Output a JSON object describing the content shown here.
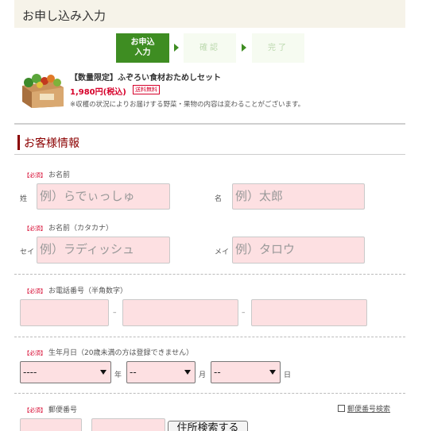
{
  "header": {
    "title": "お申し込み入力"
  },
  "steps": [
    {
      "label_line1": "お申込",
      "label_line2": "入力"
    },
    {
      "label": "確認"
    },
    {
      "label": "完了"
    }
  ],
  "product": {
    "name": "【数量限定】ふぞろい食材おためしセット",
    "price": "1,980円(税込)",
    "shipping_badge": "送料無料",
    "note": "※収穫の状況によりお届けする野菜・果物の内容は変わることがございます。"
  },
  "section": {
    "title": "お客様情報"
  },
  "form": {
    "required_tag": "【必須】",
    "name_label": "お名前",
    "last_name_prefix": "姓",
    "first_name_prefix": "名",
    "last_name_placeholder": "例）らでぃっしゅ",
    "first_name_placeholder": "例）太郎",
    "kana_label": "お名前（カタカナ）",
    "last_kana_prefix": "セイ",
    "first_kana_prefix": "メイ",
    "last_kana_placeholder": "例）ラディッシュ",
    "first_kana_placeholder": "例）タロウ",
    "phone_label": "お電話番号（半角数字）",
    "phone_separator": "–",
    "birth_label": "生年月日（20歳未満の方は登録できません）",
    "year_value": "----",
    "month_value": "--",
    "day_value": "--",
    "year_suffix": "年",
    "month_suffix": "月",
    "day_suffix": "日",
    "zip_label": "郵便番号",
    "zip_search_link": "郵便番号検索",
    "address_search_button": "住所検索する"
  }
}
